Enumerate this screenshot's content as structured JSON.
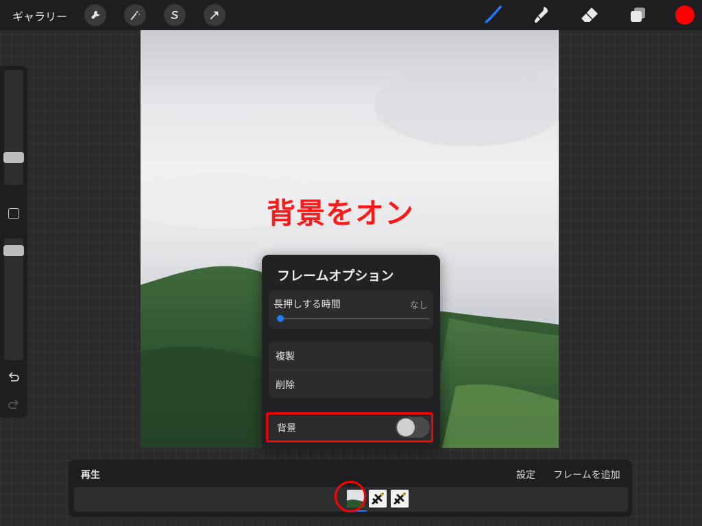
{
  "toolbar": {
    "gallery_label": "ギャラリー",
    "left_tools": [
      "wrench-icon",
      "magic-wand-icon",
      "selection-s-icon",
      "transform-arrow-icon"
    ],
    "right_tools": [
      "brush-icon",
      "smudge-icon",
      "eraser-icon",
      "layers-icon"
    ],
    "active_color": "#ff0000",
    "accent_color": "#1e7bff"
  },
  "sidebar": {
    "icons": [
      "modify-square-icon",
      "undo-icon",
      "redo-icon"
    ]
  },
  "annotation": {
    "text": "背景をオン",
    "color": "#ff1a1a"
  },
  "frame_options": {
    "title": "フレームオプション",
    "hold_duration_label": "長押しする時間",
    "hold_duration_value": "なし",
    "duplicate_label": "複製",
    "delete_label": "削除",
    "background_label": "背景",
    "background_enabled": false
  },
  "timeline": {
    "play_label": "再生",
    "settings_label": "設定",
    "add_frame_label": "フレームを追加",
    "frames": [
      "photo-frame",
      "bird-frame",
      "bird-frame"
    ]
  }
}
